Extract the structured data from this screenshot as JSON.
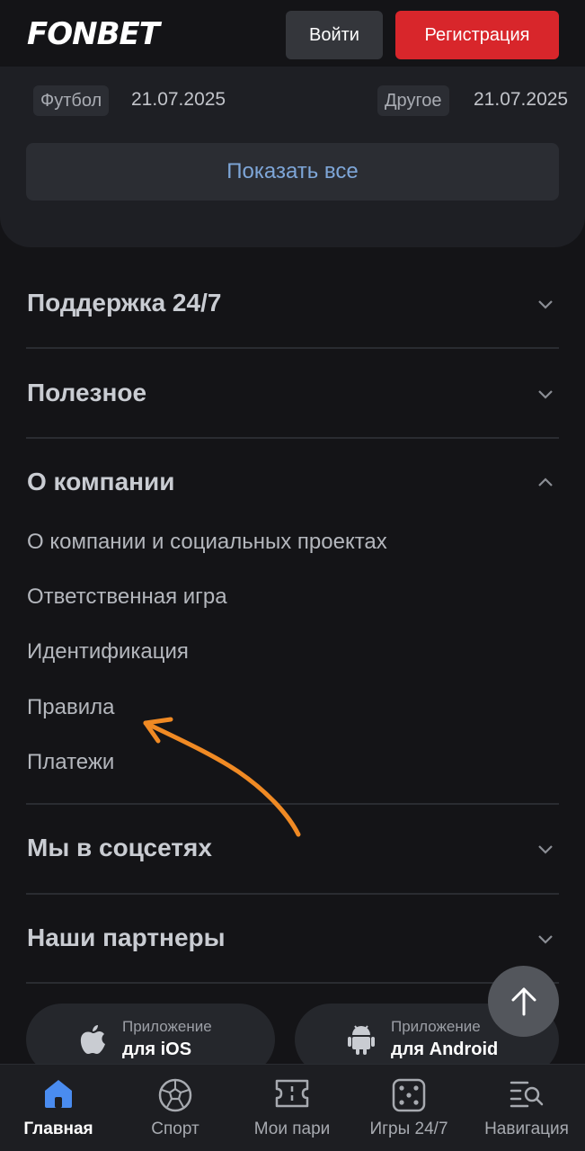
{
  "header": {
    "logo": "FONBET",
    "login_label": "Войти",
    "register_label": "Регистрация"
  },
  "news": {
    "cut_text": "(…)",
    "items": [
      {
        "tag": "Футбол",
        "date": "21.07.2025"
      },
      {
        "tag": "Другое",
        "date": "21.07.2025"
      }
    ],
    "show_all_label": "Показать все"
  },
  "footer_sections": [
    {
      "title": "Поддержка 24/7",
      "expanded": false
    },
    {
      "title": "Полезное",
      "expanded": false
    },
    {
      "title": "О компании",
      "expanded": true,
      "links": [
        "О компании и социальных проектах",
        "Ответственная игра",
        "Идентификация",
        "Правила",
        "Платежи"
      ]
    },
    {
      "title": "Мы в соцсетях",
      "expanded": false
    },
    {
      "title": "Наши партнеры",
      "expanded": false
    }
  ],
  "apps": [
    {
      "small": "Приложение",
      "big": "для iOS",
      "icon": "apple-icon"
    },
    {
      "small": "Приложение",
      "big": "для Android",
      "icon": "android-icon"
    }
  ],
  "bottom_nav": [
    {
      "label": "Главная",
      "icon": "home-icon",
      "active": true
    },
    {
      "label": "Спорт",
      "icon": "soccer-ball-icon",
      "active": false
    },
    {
      "label": "Мои пари",
      "icon": "ticket-icon",
      "active": false
    },
    {
      "label": "Игры 24/7",
      "icon": "dice-icon",
      "active": false
    },
    {
      "label": "Навигация",
      "icon": "menu-search-icon",
      "active": false
    }
  ],
  "colors": {
    "background": "#141417",
    "card": "#1e1f24",
    "accent_red": "#d8262b",
    "link_blue": "#7ea6d8",
    "active_nav_blue": "#4a8cf0",
    "annotation_orange": "#f08a24"
  }
}
